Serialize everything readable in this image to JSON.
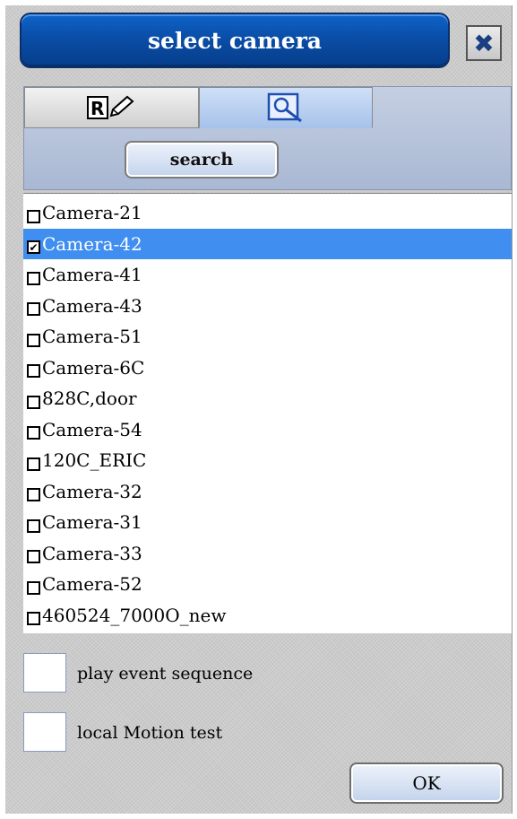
{
  "dialog": {
    "title": "select camera",
    "close_icon": "close-x-icon"
  },
  "tabs": [
    {
      "icon": "remote-edit-icon",
      "active": false
    },
    {
      "icon": "magnifier-search-icon",
      "active": true
    }
  ],
  "search_button": {
    "label": "search"
  },
  "cameras": [
    {
      "name": "Camera-21",
      "checked": false,
      "selected": false
    },
    {
      "name": "Camera-42",
      "checked": true,
      "selected": true
    },
    {
      "name": "Camera-41",
      "checked": false,
      "selected": false
    },
    {
      "name": "Camera-43",
      "checked": false,
      "selected": false
    },
    {
      "name": "Camera-51",
      "checked": false,
      "selected": false
    },
    {
      "name": "Camera-6C",
      "checked": false,
      "selected": false
    },
    {
      "name": "828C,door",
      "checked": false,
      "selected": false
    },
    {
      "name": "Camera-54",
      "checked": false,
      "selected": false
    },
    {
      "name": "120C_ERIC",
      "checked": false,
      "selected": false
    },
    {
      "name": "Camera-32",
      "checked": false,
      "selected": false
    },
    {
      "name": "Camera-31",
      "checked": false,
      "selected": false
    },
    {
      "name": "Camera-33",
      "checked": false,
      "selected": false
    },
    {
      "name": "Camera-52",
      "checked": false,
      "selected": false
    },
    {
      "name": "460524_7000O_new",
      "checked": false,
      "selected": false
    }
  ],
  "options": {
    "play_event_sequence": {
      "label": "play event sequence",
      "checked": false
    },
    "local_motion_test": {
      "label": "local Motion test",
      "checked": false
    }
  },
  "ok_button": {
    "label": "OK"
  },
  "colors": {
    "title_bar": "#0a4ea8",
    "selected_row": "#3f8ef0",
    "panel_bg": "#cbcbcb"
  }
}
